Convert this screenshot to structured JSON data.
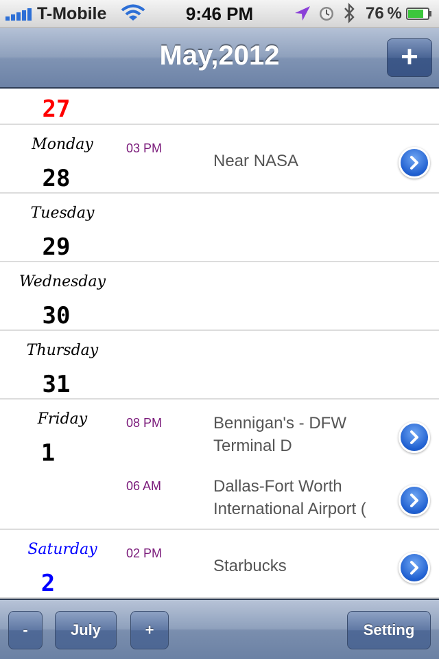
{
  "status_bar": {
    "carrier": "T-Mobile",
    "time": "9:46 PM",
    "battery": "76 %",
    "icons": [
      "signal-icon",
      "wifi-icon",
      "location-icon",
      "alarm-clock-icon",
      "bluetooth-icon",
      "battery-icon"
    ]
  },
  "nav": {
    "title": "May,2012",
    "add_label": "+"
  },
  "days": [
    {
      "day": "",
      "date": "27",
      "color": "#ff0000",
      "events": []
    },
    {
      "day": "Monday",
      "date": "28",
      "color": "#000000",
      "events": [
        {
          "time": "03 PM",
          "title": "Near NASA"
        }
      ]
    },
    {
      "day": "Tuesday",
      "date": "29",
      "color": "#000000",
      "events": []
    },
    {
      "day": "Wednesday",
      "date": "30",
      "color": "#000000",
      "events": []
    },
    {
      "day": "Thursday",
      "date": "31",
      "color": "#000000",
      "events": []
    },
    {
      "day": "Friday",
      "date": "1",
      "color": "#000000",
      "events": [
        {
          "time": "08 PM",
          "title": "Bennigan's - DFW Terminal D"
        },
        {
          "time": "06 AM",
          "title": "Dallas-Fort Worth International Airport ("
        }
      ]
    },
    {
      "day": "Saturday",
      "date": "2",
      "color": "#0000ff",
      "events": [
        {
          "time": "02 PM",
          "title": "Starbucks"
        }
      ]
    }
  ],
  "toolbar": {
    "prev_label": "-",
    "month_label": "July",
    "next_label": "+",
    "setting_label": "Setting"
  },
  "colors": {
    "bar_blue": "#6c82a6",
    "event_time": "#7a1a7a",
    "sunday_red": "#ff0000",
    "saturday_blue": "#0000ff"
  }
}
